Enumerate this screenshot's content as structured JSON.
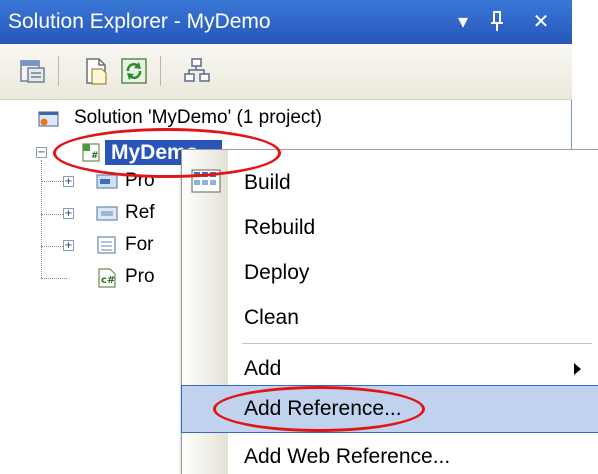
{
  "window": {
    "title": "Solution Explorer - MyDemo",
    "pin_glyph": "I",
    "close_glyph": "✕",
    "dropdown_glyph": "▾"
  },
  "toolbar": {
    "buttons": [
      "properties-icon",
      "show-all-files-icon",
      "refresh-icon",
      "class-view-icon"
    ]
  },
  "tree": {
    "solution_label": "Solution 'MyDemo' (1 project)",
    "project_label": "MyDemo",
    "children": [
      {
        "label": "Pro",
        "icon": "properties-folder-icon",
        "expandable": true
      },
      {
        "label": "Ref",
        "icon": "references-folder-icon",
        "expandable": true
      },
      {
        "label": "For",
        "icon": "form-icon",
        "expandable": true
      },
      {
        "label": "Pro",
        "icon": "csharp-file-icon",
        "expandable": false
      }
    ]
  },
  "context_menu": {
    "items": [
      {
        "label": "Build",
        "icon": "build-icon"
      },
      {
        "label": "Rebuild"
      },
      {
        "label": "Deploy"
      },
      {
        "label": "Clean"
      },
      {
        "label": "Add",
        "submenu": true
      },
      {
        "label": "Add Reference...",
        "highlighted": true
      },
      {
        "label": "Add Web Reference..."
      }
    ]
  },
  "colors": {
    "titlebar": "#2f65c7",
    "selection": "#2a55b8",
    "menu_highlight": "#c1d2ee",
    "annotation": "#e01515"
  }
}
